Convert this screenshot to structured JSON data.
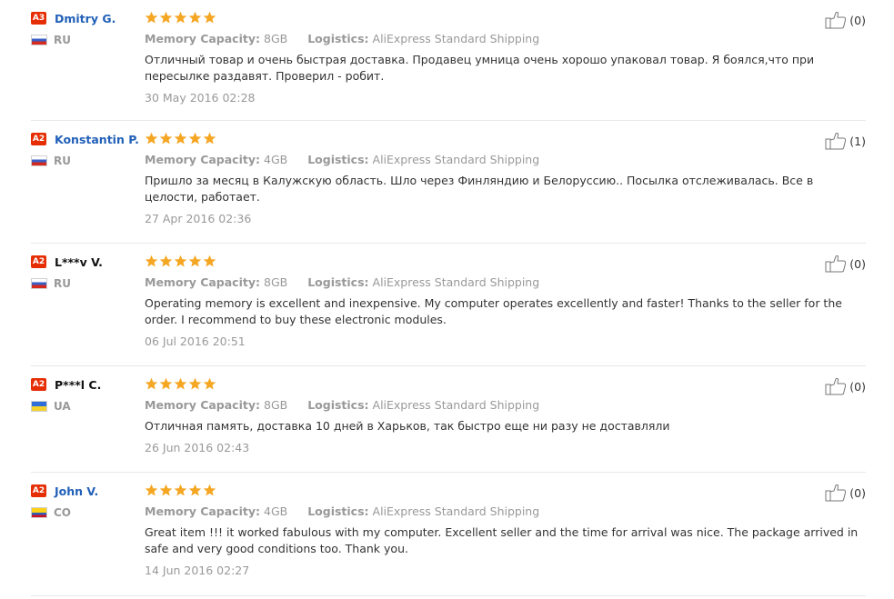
{
  "reviews": [
    {
      "level": "A3",
      "name": "Dmitry G.",
      "country": "RU",
      "meta": {
        "k1": "Memory Capacity:",
        "v1": "8GB",
        "k2": "Logistics:",
        "v2": "AliExpress Standard Shipping"
      },
      "text": "Отличный товар и очень быстрая доставка. Продавец умница очень хорошо упаковал товар. Я боялся,что при пересылке раздавят. Проверил - робит.",
      "date": "30 May 2016 02:28",
      "helpful": "(0)"
    },
    {
      "level": "A2",
      "name": "Konstantin P.",
      "country": "RU",
      "meta": {
        "k1": "Memory Capacity:",
        "v1": "4GB",
        "k2": "Logistics:",
        "v2": "AliExpress Standard Shipping"
      },
      "text": "Пришло за месяц в Калужскую область. Шло через Финляндию и Белоруссию.. Посылка отслеживалась. Все в целости, работает.",
      "date": "27 Apr 2016 02:36",
      "helpful": "(1)"
    },
    {
      "level": "A2",
      "name": "L***v V.",
      "country": "RU",
      "meta": {
        "k1": "Memory Capacity:",
        "v1": "8GB",
        "k2": "Logistics:",
        "v2": "AliExpress Standard Shipping"
      },
      "text": "Operating memory is excellent and inexpensive. My computer operates excellently and faster! Thanks to the seller for the order. I recommend to buy these electronic modules.",
      "date": "06 Jul 2016 20:51",
      "helpful": "(0)"
    },
    {
      "level": "A2",
      "name": "P***l C.",
      "country": "UA",
      "meta": {
        "k1": "Memory Capacity:",
        "v1": "8GB",
        "k2": "Logistics:",
        "v2": "AliExpress Standard Shipping"
      },
      "text": "Отличная память, доставка 10 дней в Харьков, так быстро еще ни разу не доставляли",
      "date": "26 Jun 2016 02:43",
      "helpful": "(0)"
    },
    {
      "level": "A2",
      "name": "John V.",
      "country": "CO",
      "meta": {
        "k1": "Memory Capacity:",
        "v1": "4GB",
        "k2": "Logistics:",
        "v2": "AliExpress Standard Shipping"
      },
      "text": "Great item !!! it worked fabulous with my computer. Excellent seller and the time for arrival was nice. The package arrived in safe and very good conditions too. Thank you.",
      "date": "14 Jun 2016 02:27",
      "helpful": "(0)"
    }
  ],
  "colors": {
    "star": "#f5a623",
    "level_badge": "#e62e04",
    "link": "#2160b8"
  },
  "ratings": [
    5,
    5,
    5,
    5,
    5
  ],
  "icons": {
    "thumb": "thumbs-up-icon",
    "star": "star-icon"
  }
}
